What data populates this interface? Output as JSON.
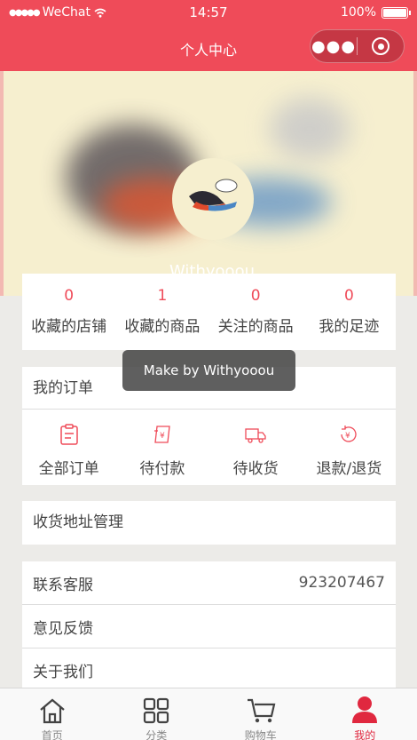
{
  "status_bar": {
    "carrier": "WeChat",
    "time": "14:57",
    "battery": "100%"
  },
  "nav": {
    "title": "个人中心",
    "more_icon": "more-dots-icon",
    "close_icon": "target-close-icon"
  },
  "profile": {
    "username": "Withyooou"
  },
  "stats": [
    {
      "value": "0",
      "label": "收藏的店铺"
    },
    {
      "value": "1",
      "label": "收藏的商品"
    },
    {
      "value": "0",
      "label": "关注的商品"
    },
    {
      "value": "0",
      "label": "我的足迹"
    }
  ],
  "orders": {
    "title": "我的订单",
    "items": [
      {
        "label": "全部订单",
        "icon": "clipboard-icon"
      },
      {
        "label": "待付款",
        "icon": "payment-icon"
      },
      {
        "label": "待收货",
        "icon": "truck-icon"
      },
      {
        "label": "退款/退货",
        "icon": "refund-icon"
      }
    ]
  },
  "address": {
    "label": "收货地址管理"
  },
  "others": {
    "contact_label": "联系客服",
    "contact_value": "923207467",
    "feedback_label": "意见反馈",
    "about_label": "关于我们"
  },
  "toast": {
    "text": "Make by Withyooou"
  },
  "tabbar": [
    {
      "label": "首页",
      "icon": "home-icon"
    },
    {
      "label": "分类",
      "icon": "category-icon"
    },
    {
      "label": "购物车",
      "icon": "cart-icon"
    },
    {
      "label": "我的",
      "icon": "user-icon",
      "active": true
    }
  ],
  "colors": {
    "accent": "#ef4b59",
    "active_tab": "#e0283f",
    "background": "#ecebe8"
  }
}
